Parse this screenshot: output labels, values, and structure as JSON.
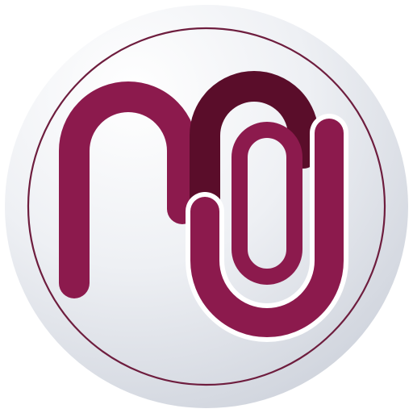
{
  "logo": {
    "colors": {
      "background": "#ffffff",
      "badge_light": "#ffffff",
      "badge_mid": "#eef0f4",
      "badge_dark": "#c9ced8",
      "ring": "#6e1d3e",
      "primary": "#8c1a4d",
      "primary_dark": "#5a0d2a",
      "separator": "#ffffff"
    },
    "icons": {
      "badge": "circle-badge-icon",
      "mark": "monogram-icon"
    }
  }
}
